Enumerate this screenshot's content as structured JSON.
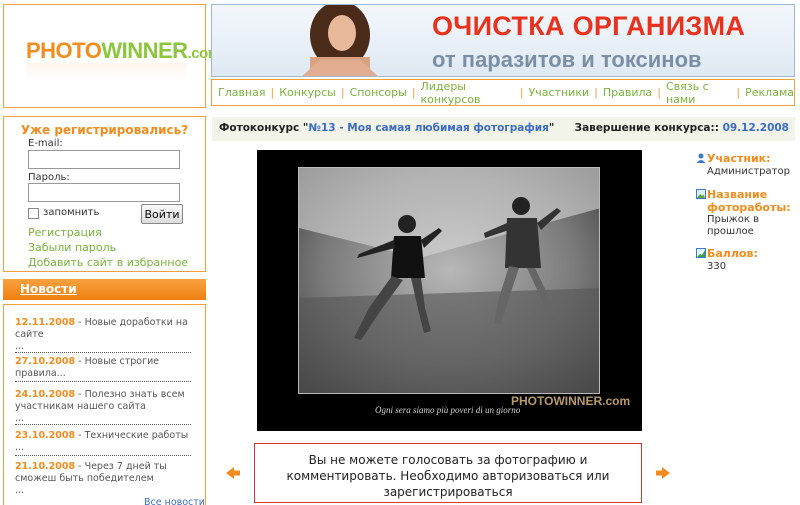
{
  "logo": {
    "part1": "PHOTO",
    "part2": "WINNER",
    "domain": ".com"
  },
  "banner": {
    "line1": "ОЧИСТКА ОРГАНИЗМА",
    "line2": "от паразитов и токсинов"
  },
  "nav": [
    "Главная",
    "Конкурсы",
    "Спонсоры",
    "Лидеры конкурсов",
    "Участники",
    "Правила",
    "Связь с нами",
    "Реклама"
  ],
  "login": {
    "heading": "Уже регистрировались?",
    "email_label": "E-mail:",
    "email_value": "",
    "password_label": "Пароль:",
    "password_value": "",
    "remember_label": "запомнить",
    "submit_label": "Войти",
    "links": [
      "Регистрация",
      "Забыли пароль",
      "Добавить сайт в избранное"
    ]
  },
  "news": {
    "title": "Новости",
    "items": [
      {
        "date": "12.11.2008",
        "text": "Новые доработки на сайте",
        "more": "..."
      },
      {
        "date": "27.10.2008",
        "text": "Новые строгие правила...",
        "more": ""
      },
      {
        "date": "24.10.2008",
        "text": "Полезно знать всем участникам нашего сайта",
        "more": "..."
      },
      {
        "date": "23.10.2008",
        "text": "Технические работы",
        "more": "..."
      },
      {
        "date": "21.10.2008",
        "text": "Через 7 дней ты сможеш быть победителем",
        "more": "..."
      }
    ],
    "all_link": "Все новости"
  },
  "contest": {
    "prefix": "Фотоконкурс \"",
    "link": "№13 - Моя самая любимая фотография",
    "suffix": "\"",
    "end_label": "Завершение конкурса::",
    "end_date": "09.12.2008"
  },
  "photo": {
    "watermark": "Ogni sera siamo più poveri di un giorno",
    "logo": "PHOTOWINNER.com"
  },
  "info": {
    "participant_label": "Участник:",
    "participant_value": "Администратор",
    "name_label": "Название фотоработы:",
    "name_value": "Прыжок в прошлое",
    "score_label": "Баллов:",
    "score_value": "330"
  },
  "message": "Вы не можете голосовать за фотографию и комментировать. Необходимо авторизоваться или зарегистрироваться",
  "colors": {
    "accent_orange": "#f28c1e",
    "accent_green": "#78b33a",
    "link_blue": "#3b6bc8"
  }
}
